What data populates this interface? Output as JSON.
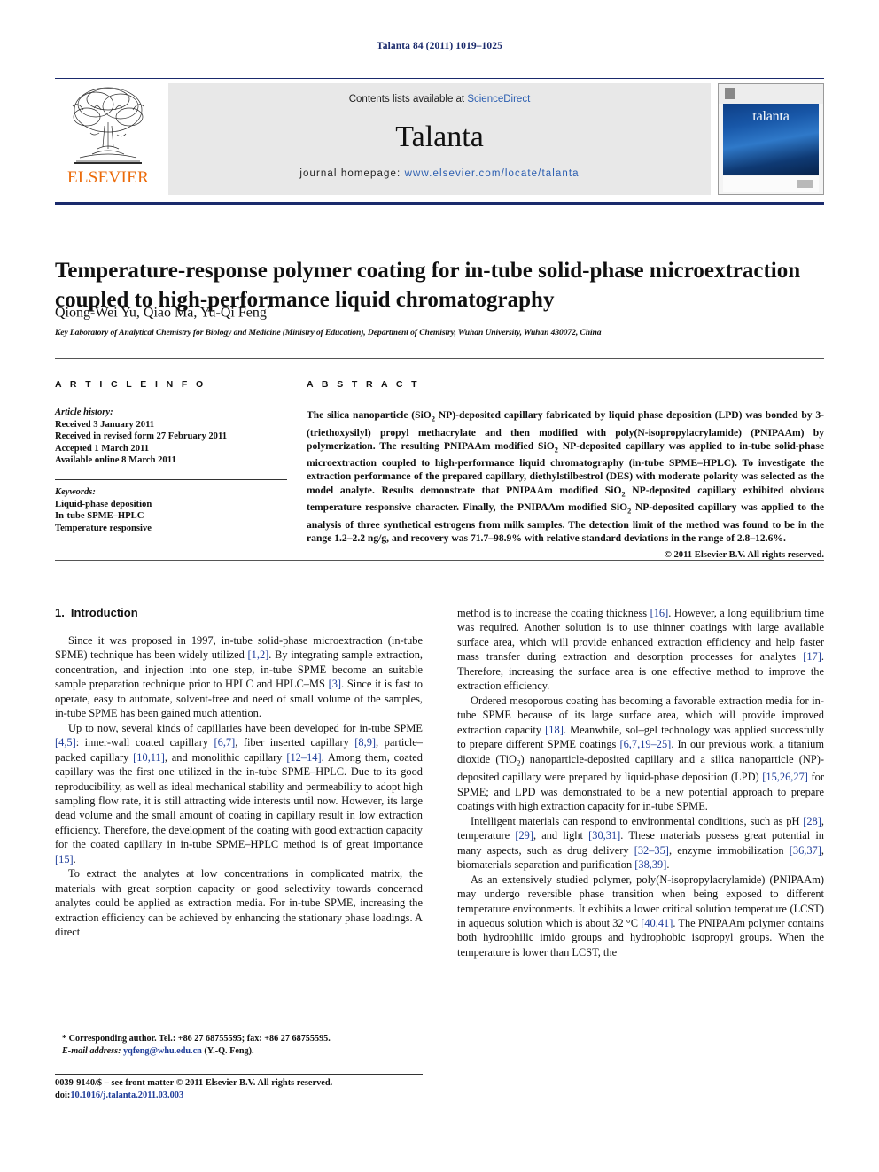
{
  "running_head": "Talanta 84 (2011) 1019–1025",
  "masthead": {
    "contents_prefix": "Contents lists available at ",
    "sciencedirect": "ScienceDirect",
    "journal_name": "Talanta",
    "homepage_label": "journal homepage:",
    "homepage_url": "www.elsevier.com/locate/talanta",
    "publisher": "ELSEVIER",
    "cover_title": "talanta",
    "link_color": "#2a5db0",
    "rule_color": "#1a2a6c",
    "publisher_color": "#eb6a09"
  },
  "article": {
    "title": "Temperature-response polymer coating for in-tube solid-phase microextraction coupled to high-performance liquid chromatography",
    "authors": "Qiong-Wei Yu, Qiao Ma, Yu-Qi Feng",
    "corresponding_marker": "*",
    "affiliation": "Key Laboratory of Analytical Chemistry for Biology and Medicine (Ministry of Education), Department of Chemistry, Wuhan University, Wuhan 430072, China"
  },
  "article_info": {
    "heading": "A R T I C L E   I N F O",
    "history_label": "Article history:",
    "history": [
      "Received 3 January 2011",
      "Received in revised form 27 February 2011",
      "Accepted 1 March 2011",
      "Available online 8 March 2011"
    ],
    "keywords_label": "Keywords:",
    "keywords": [
      "Liquid-phase deposition",
      "In-tube SPME–HPLC",
      "Temperature responsive"
    ]
  },
  "abstract": {
    "heading": "A B S T R A C T",
    "body_part1": "The silica nanoparticle (SiO",
    "body_sub1": "2",
    "body_part2": " NP)-deposited capillary fabricated by liquid phase deposition (LPD) was bonded by 3-(triethoxysilyl) propyl methacrylate and then modified with poly(N-isopropylacrylamide) (PNIPAAm) by polymerization. The resulting PNIPAAm modified SiO",
    "body_sub2": "2",
    "body_part3": " NP-deposited capillary was applied to in-tube solid-phase microextraction coupled to high-performance liquid chromatography (in-tube SPME–HPLC). To investigate the extraction performance of the prepared capillary, diethylstilbestrol (DES) with moderate polarity was selected as the model analyte. Results demonstrate that PNIPAAm modified SiO",
    "body_sub3": "2",
    "body_part4": " NP-deposited capillary exhibited obvious temperature responsive character. Finally, the PNIPAAm modified SiO",
    "body_sub4": "2",
    "body_part5": " NP-deposited capillary was applied to the analysis of three synthetical estrogens from milk samples. The detection limit of the method was found to be in the range 1.2–2.2 ng/g, and recovery was 71.7–98.9% with relative standard deviations in the range of 2.8–12.6%.",
    "copyright": "© 2011 Elsevier B.V. All rights reserved."
  },
  "sections": {
    "intro_number": "1.",
    "intro_title": "Introduction"
  },
  "left_column": {
    "p1_a": "Since it was proposed in 1997, in-tube solid-phase microextraction (in-tube SPME) technique has been widely utilized ",
    "p1_c1": "[1,2]",
    "p1_b": ". By integrating sample extraction, concentration, and injection into one step, in-tube SPME become an suitable sample preparation technique prior to HPLC and HPLC–MS ",
    "p1_c2": "[3]",
    "p1_c": ". Since it is fast to operate, easy to automate, solvent-free and need of small volume of the samples, in-tube SPME has been gained much attention.",
    "p2_a": "Up to now, several kinds of capillaries have been developed for in-tube SPME ",
    "p2_c1": "[4,5]",
    "p2_b": ": inner-wall coated capillary ",
    "p2_c2": "[6,7]",
    "p2_c": ", fiber inserted capillary ",
    "p2_c3": "[8,9]",
    "p2_d": ", particle–packed capillary ",
    "p2_c4": "[10,11]",
    "p2_e": ", and monolithic capillary ",
    "p2_c5": "[12–14]",
    "p2_f": ". Among them, coated capillary was the first one utilized in the in-tube SPME–HPLC. Due to its good reproducibility, as well as ideal mechanical stability and permeability to adopt high sampling flow rate, it is still attracting wide interests until now. However, its large dead volume and the small amount of coating in capillary result in low extraction efficiency. Therefore, the development of the coating with good extraction capacity for the coated capillary in in-tube SPME–HPLC method is of great importance ",
    "p2_c6": "[15]",
    "p2_g": ".",
    "p3": "To extract the analytes at low concentrations in complicated matrix, the materials with great sorption capacity or good selectivity towards concerned analytes could be applied as extraction media. For in-tube SPME, increasing the extraction efficiency can be achieved by enhancing the stationary phase loadings. A direct"
  },
  "right_column": {
    "p1_a": "method is to increase the coating thickness ",
    "p1_c1": "[16]",
    "p1_b": ". However, a long equilibrium time was required. Another solution is to use thinner coatings with large available surface area, which will provide enhanced extraction efficiency and help faster mass transfer during extraction and desorption processes for analytes ",
    "p1_c2": "[17]",
    "p1_c": ". Therefore, increasing the surface area is one effective method to improve the extraction efficiency.",
    "p2_a": "Ordered mesoporous coating has becoming a favorable extraction media for in-tube SPME because of its large surface area, which will provide improved extraction capacity ",
    "p2_c1": "[18]",
    "p2_b": ". Meanwhile, sol–gel technology was applied successfully to prepare different SPME coatings ",
    "p2_c2": "[6,7,19–25]",
    "p2_c": ". In our previous work, a titanium dioxide (TiO",
    "p2_sub": "2",
    "p2_d": ") nanoparticle-deposited capillary and a silica nanoparticle (NP)-deposited capillary were prepared by liquid-phase deposition (LPD) ",
    "p2_c3": "[15,26,27]",
    "p2_e": " for SPME; and LPD was demonstrated to be a new potential approach to prepare coatings with high extraction capacity for in-tube SPME.",
    "p3_a": "Intelligent materials can respond to environmental conditions, such as pH ",
    "p3_c1": "[28]",
    "p3_b": ", temperature ",
    "p3_c2": "[29]",
    "p3_c": ", and light ",
    "p3_c3": "[30,31]",
    "p3_d": ". These materials possess great potential in many aspects, such as drug delivery ",
    "p3_c4": "[32–35]",
    "p3_e": ", enzyme immobilization ",
    "p3_c5": "[36,37]",
    "p3_f": ", biomaterials separation and purification ",
    "p3_c6": "[38,39]",
    "p3_g": ".",
    "p4_a": "As an extensively studied polymer, poly(N-isopropylacrylamide) (PNIPAAm) may undergo reversible phase transition when being exposed to different temperature environments. It exhibits a lower critical solution temperature (LCST) in aqueous solution which is about 32 °C ",
    "p4_c1": "[40,41]",
    "p4_b": ". The PNIPAAm polymer contains both hydrophilic imido groups and hydrophobic isopropyl groups. When the temperature is lower than LCST, the"
  },
  "footnote": {
    "marker": "*",
    "line1": " Corresponding author. Tel.: +86 27 68755595; fax: +86 27 68755595.",
    "email_label": "E-mail address:",
    "email": "yqfeng@whu.edu.cn",
    "email_suffix": " (Y.-Q. Feng)."
  },
  "page_footer": {
    "line1": "0039-9140/$ – see front matter © 2011 Elsevier B.V. All rights reserved.",
    "doi_label": "doi:",
    "doi": "10.1016/j.talanta.2011.03.003"
  }
}
